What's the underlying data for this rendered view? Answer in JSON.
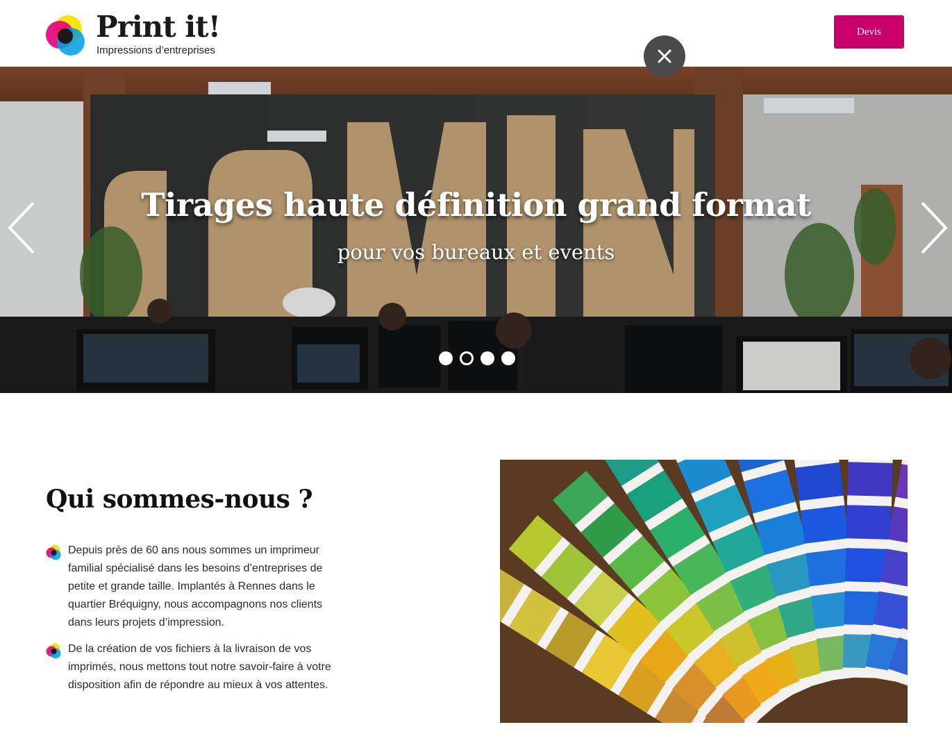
{
  "header": {
    "logo_title": "Print it!",
    "logo_subtitle": "Impressions d’entreprises",
    "devis_label": "Devis"
  },
  "hero": {
    "title": "Tirages haute définition grand format",
    "subtitle": "pour vos bureaux et events",
    "slides_total": 4,
    "active_slide": 2
  },
  "about": {
    "title": "Qui sommes-nous ?",
    "items": [
      "Depuis près de 60 ans nous sommes un imprimeur familial spécialisé dans les besoins d’entreprises de petite et grande taille. Implantés à Rennes dans le quartier Bréquigny, nous accompagnons nos clients dans leurs projets d’impression.",
      "De la création de vos fichiers à la livraison de vos imprimés, nous mettons tout notre savoir-faire à votre disposition afin de répondre au mieux à vos attentes."
    ]
  },
  "colors": {
    "accent": "#c8006b",
    "close_bg": "#4a4a4a"
  },
  "icons": [
    "close-icon",
    "chevron-left-icon",
    "chevron-right-icon",
    "cmyk-bullet-icon"
  ]
}
